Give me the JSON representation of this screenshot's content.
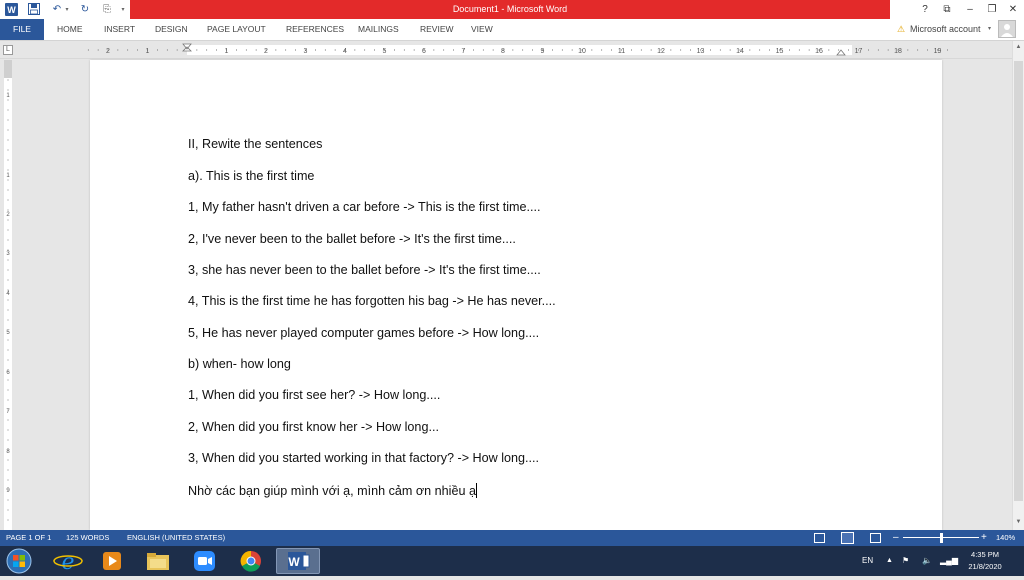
{
  "window": {
    "title": "Document1 - Microsoft Word",
    "controls": {
      "help": "?",
      "restore_ribbon": "⧉",
      "minimize": "–",
      "maximize": "❐",
      "close": "✕"
    }
  },
  "quick_access": {
    "undo": "↶",
    "redo": "↻",
    "customize": "⎘"
  },
  "ribbon": {
    "tabs": [
      "FILE",
      "HOME",
      "INSERT",
      "DESIGN",
      "PAGE LAYOUT",
      "REFERENCES",
      "MAILINGS",
      "REVIEW",
      "VIEW"
    ],
    "account": "Microsoft account",
    "account_warning": "⚠"
  },
  "ruler": {
    "tab_selector": "L",
    "numbers": [
      "2",
      "1",
      "1",
      "2",
      "3",
      "4",
      "5",
      "6",
      "7",
      "8",
      "9",
      "10",
      "11",
      "12",
      "13",
      "14",
      "15",
      "16",
      "17",
      "18",
      "19"
    ],
    "vertical_numbers": [
      "1",
      "1",
      "2",
      "3",
      "4",
      "5",
      "6",
      "7",
      "8",
      "9"
    ]
  },
  "document": {
    "lines": [
      "II, Rewite the sentences",
      "a). This is the first time",
      "1, My father hasn't driven a car before -> This is the first time....",
      "2, I've never been to  the ballet before -> It's the first time....",
      "3, she has never been to the ballet before -> It's the first time....",
      "4, This is the first time he has forgotten his bag -> He has never....",
      "5, He has never played computer games before -> How long....",
      "b) when- how long",
      "1, When did you first see her? -> How long....",
      "2, When did you first know her -> How long...",
      "3, When did you started working in that factory? -> How long....",
      "Nhờ các bạn giúp mình với ạ, mình cảm ơn nhiều ạ"
    ]
  },
  "statusbar": {
    "page": "PAGE 1 OF 1",
    "words": "125 WORDS",
    "language": "ENGLISH (UNITED STATES)",
    "zoom": "140%",
    "zoom_minus": "–",
    "zoom_plus": "+"
  },
  "taskbar": {
    "language": "EN",
    "time": "4:35 PM",
    "date": "21/8/2020"
  },
  "colors": {
    "word_blue": "#2b579a",
    "title_red": "#e32a2a",
    "taskbar": "#1d2e4a"
  }
}
